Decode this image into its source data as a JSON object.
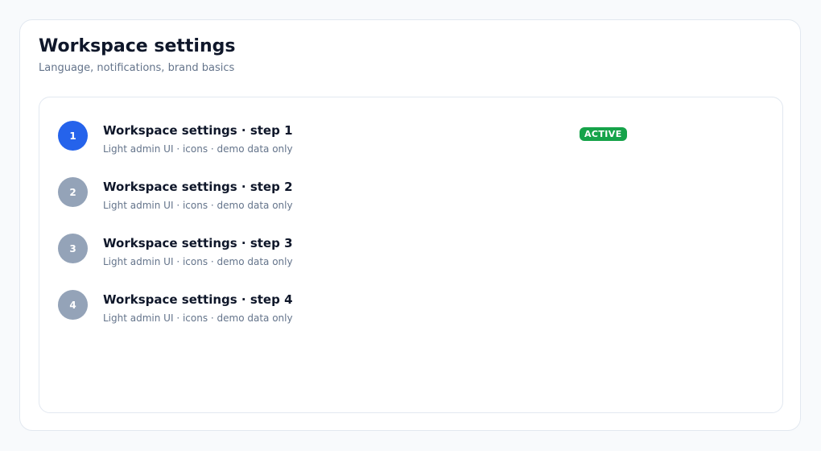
{
  "header": {
    "title": "Workspace settings",
    "subtitle": "Language, notifications, brand basics"
  },
  "steps": [
    {
      "number": "1",
      "title": "Workspace settings · step 1",
      "description": "Light admin UI · icons · demo data only",
      "status": "ACTIVE"
    },
    {
      "number": "2",
      "title": "Workspace settings · step 2",
      "description": "Light admin UI · icons · demo data only"
    },
    {
      "number": "3",
      "title": "Workspace settings · step 3",
      "description": "Light admin UI · icons · demo data only"
    },
    {
      "number": "4",
      "title": "Workspace settings · step 4",
      "description": "Light admin UI · icons · demo data only"
    }
  ],
  "colors": {
    "active_step": "#2563eb",
    "inactive_step": "#94a3b8",
    "active_badge": "#16a34a"
  }
}
